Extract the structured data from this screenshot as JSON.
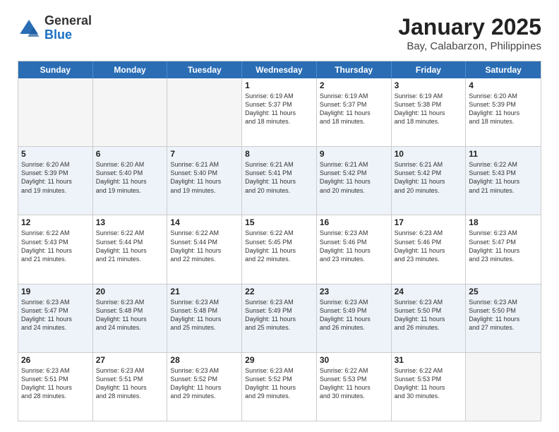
{
  "logo": {
    "general": "General",
    "blue": "Blue"
  },
  "title": "January 2025",
  "subtitle": "Bay, Calabarzon, Philippines",
  "days": [
    "Sunday",
    "Monday",
    "Tuesday",
    "Wednesday",
    "Thursday",
    "Friday",
    "Saturday"
  ],
  "rows": [
    [
      {
        "day": "",
        "lines": []
      },
      {
        "day": "",
        "lines": []
      },
      {
        "day": "",
        "lines": []
      },
      {
        "day": "1",
        "lines": [
          "Sunrise: 6:19 AM",
          "Sunset: 5:37 PM",
          "Daylight: 11 hours",
          "and 18 minutes."
        ]
      },
      {
        "day": "2",
        "lines": [
          "Sunrise: 6:19 AM",
          "Sunset: 5:37 PM",
          "Daylight: 11 hours",
          "and 18 minutes."
        ]
      },
      {
        "day": "3",
        "lines": [
          "Sunrise: 6:19 AM",
          "Sunset: 5:38 PM",
          "Daylight: 11 hours",
          "and 18 minutes."
        ]
      },
      {
        "day": "4",
        "lines": [
          "Sunrise: 6:20 AM",
          "Sunset: 5:39 PM",
          "Daylight: 11 hours",
          "and 18 minutes."
        ]
      }
    ],
    [
      {
        "day": "5",
        "lines": [
          "Sunrise: 6:20 AM",
          "Sunset: 5:39 PM",
          "Daylight: 11 hours",
          "and 19 minutes."
        ]
      },
      {
        "day": "6",
        "lines": [
          "Sunrise: 6:20 AM",
          "Sunset: 5:40 PM",
          "Daylight: 11 hours",
          "and 19 minutes."
        ]
      },
      {
        "day": "7",
        "lines": [
          "Sunrise: 6:21 AM",
          "Sunset: 5:40 PM",
          "Daylight: 11 hours",
          "and 19 minutes."
        ]
      },
      {
        "day": "8",
        "lines": [
          "Sunrise: 6:21 AM",
          "Sunset: 5:41 PM",
          "Daylight: 11 hours",
          "and 20 minutes."
        ]
      },
      {
        "day": "9",
        "lines": [
          "Sunrise: 6:21 AM",
          "Sunset: 5:42 PM",
          "Daylight: 11 hours",
          "and 20 minutes."
        ]
      },
      {
        "day": "10",
        "lines": [
          "Sunrise: 6:21 AM",
          "Sunset: 5:42 PM",
          "Daylight: 11 hours",
          "and 20 minutes."
        ]
      },
      {
        "day": "11",
        "lines": [
          "Sunrise: 6:22 AM",
          "Sunset: 5:43 PM",
          "Daylight: 11 hours",
          "and 21 minutes."
        ]
      }
    ],
    [
      {
        "day": "12",
        "lines": [
          "Sunrise: 6:22 AM",
          "Sunset: 5:43 PM",
          "Daylight: 11 hours",
          "and 21 minutes."
        ]
      },
      {
        "day": "13",
        "lines": [
          "Sunrise: 6:22 AM",
          "Sunset: 5:44 PM",
          "Daylight: 11 hours",
          "and 21 minutes."
        ]
      },
      {
        "day": "14",
        "lines": [
          "Sunrise: 6:22 AM",
          "Sunset: 5:44 PM",
          "Daylight: 11 hours",
          "and 22 minutes."
        ]
      },
      {
        "day": "15",
        "lines": [
          "Sunrise: 6:22 AM",
          "Sunset: 5:45 PM",
          "Daylight: 11 hours",
          "and 22 minutes."
        ]
      },
      {
        "day": "16",
        "lines": [
          "Sunrise: 6:23 AM",
          "Sunset: 5:46 PM",
          "Daylight: 11 hours",
          "and 23 minutes."
        ]
      },
      {
        "day": "17",
        "lines": [
          "Sunrise: 6:23 AM",
          "Sunset: 5:46 PM",
          "Daylight: 11 hours",
          "and 23 minutes."
        ]
      },
      {
        "day": "18",
        "lines": [
          "Sunrise: 6:23 AM",
          "Sunset: 5:47 PM",
          "Daylight: 11 hours",
          "and 23 minutes."
        ]
      }
    ],
    [
      {
        "day": "19",
        "lines": [
          "Sunrise: 6:23 AM",
          "Sunset: 5:47 PM",
          "Daylight: 11 hours",
          "and 24 minutes."
        ]
      },
      {
        "day": "20",
        "lines": [
          "Sunrise: 6:23 AM",
          "Sunset: 5:48 PM",
          "Daylight: 11 hours",
          "and 24 minutes."
        ]
      },
      {
        "day": "21",
        "lines": [
          "Sunrise: 6:23 AM",
          "Sunset: 5:48 PM",
          "Daylight: 11 hours",
          "and 25 minutes."
        ]
      },
      {
        "day": "22",
        "lines": [
          "Sunrise: 6:23 AM",
          "Sunset: 5:49 PM",
          "Daylight: 11 hours",
          "and 25 minutes."
        ]
      },
      {
        "day": "23",
        "lines": [
          "Sunrise: 6:23 AM",
          "Sunset: 5:49 PM",
          "Daylight: 11 hours",
          "and 26 minutes."
        ]
      },
      {
        "day": "24",
        "lines": [
          "Sunrise: 6:23 AM",
          "Sunset: 5:50 PM",
          "Daylight: 11 hours",
          "and 26 minutes."
        ]
      },
      {
        "day": "25",
        "lines": [
          "Sunrise: 6:23 AM",
          "Sunset: 5:50 PM",
          "Daylight: 11 hours",
          "and 27 minutes."
        ]
      }
    ],
    [
      {
        "day": "26",
        "lines": [
          "Sunrise: 6:23 AM",
          "Sunset: 5:51 PM",
          "Daylight: 11 hours",
          "and 28 minutes."
        ]
      },
      {
        "day": "27",
        "lines": [
          "Sunrise: 6:23 AM",
          "Sunset: 5:51 PM",
          "Daylight: 11 hours",
          "and 28 minutes."
        ]
      },
      {
        "day": "28",
        "lines": [
          "Sunrise: 6:23 AM",
          "Sunset: 5:52 PM",
          "Daylight: 11 hours",
          "and 29 minutes."
        ]
      },
      {
        "day": "29",
        "lines": [
          "Sunrise: 6:23 AM",
          "Sunset: 5:52 PM",
          "Daylight: 11 hours",
          "and 29 minutes."
        ]
      },
      {
        "day": "30",
        "lines": [
          "Sunrise: 6:22 AM",
          "Sunset: 5:53 PM",
          "Daylight: 11 hours",
          "and 30 minutes."
        ]
      },
      {
        "day": "31",
        "lines": [
          "Sunrise: 6:22 AM",
          "Sunset: 5:53 PM",
          "Daylight: 11 hours",
          "and 30 minutes."
        ]
      },
      {
        "day": "",
        "lines": []
      }
    ]
  ]
}
